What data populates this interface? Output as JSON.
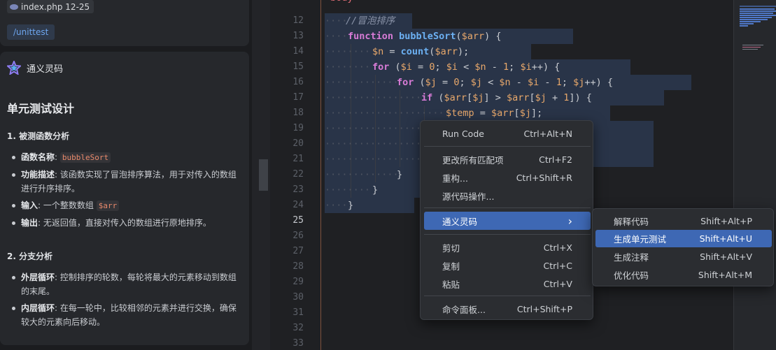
{
  "chat": {
    "file_chip": "index.php 12-25",
    "command": "/unittest",
    "assistant_name": "通义灵码",
    "heading": "单元测试设计",
    "section1": {
      "title": "1. 被测函数分析",
      "items": [
        {
          "label": "函数名称",
          "sep": ": ",
          "code": "bubbleSort",
          "text": ""
        },
        {
          "label": "功能描述",
          "sep": ": ",
          "code": "",
          "text": "该函数实现了冒泡排序算法，用于对传入的数组进行升序排序。"
        },
        {
          "label": "输入",
          "sep": ": 一个整数数组 ",
          "code": "$arr",
          "text": ""
        },
        {
          "label": "输出",
          "sep": ": ",
          "code": "",
          "text": "无返回值，直接对传入的数组进行原地排序。"
        }
      ]
    },
    "section2": {
      "title": "2. 分支分析",
      "items": [
        {
          "label": "外层循环",
          "sep": ": ",
          "code": "",
          "text": "控制排序的轮数，每轮将最大的元素移动到数组的末尾。"
        },
        {
          "label": "内层循环",
          "sep": ": ",
          "code": "",
          "text": "在每一轮中，比较相邻的元素并进行交换，确保较大的元素向后移动。"
        }
      ]
    }
  },
  "editor": {
    "top_fragment": "<body>",
    "current_line": 25,
    "lines": [
      {
        "n": 12,
        "text": "//冒泡排序"
      },
      {
        "n": 13,
        "text": "function bubbleSort($arr) {"
      },
      {
        "n": 14,
        "text": "$n = count($arr);"
      },
      {
        "n": 15,
        "text": "for ($i = 0; $i < $n - 1; $i++) {"
      },
      {
        "n": 16,
        "text": "for ($j = 0; $j < $n - $i - 1; $j++) {"
      },
      {
        "n": 17,
        "text": "if ($arr[$j] > $arr[$j + 1]) {"
      },
      {
        "n": 18,
        "text": "$temp = $arr[$j];"
      },
      {
        "n": 19,
        "text": ""
      },
      {
        "n": 20,
        "text": ""
      },
      {
        "n": 21,
        "text": ""
      },
      {
        "n": 22,
        "text": "}"
      },
      {
        "n": 23,
        "text": "}"
      },
      {
        "n": 24,
        "text": "}"
      },
      {
        "n": 25,
        "text": ""
      },
      {
        "n": 26,
        "text": ""
      },
      {
        "n": 27,
        "text": ""
      },
      {
        "n": 28,
        "text": ""
      },
      {
        "n": 29,
        "text": ""
      },
      {
        "n": 30,
        "text": ""
      },
      {
        "n": 31,
        "text": ""
      },
      {
        "n": 32,
        "text": ""
      },
      {
        "n": 33,
        "text": ""
      }
    ]
  },
  "context_menu": {
    "run_code": {
      "label": "Run Code",
      "shortcut": "Ctrl+Alt+N"
    },
    "change_all": {
      "label": "更改所有匹配项",
      "shortcut": "Ctrl+F2"
    },
    "refactor": {
      "label": "重构...",
      "shortcut": "Ctrl+Shift+R"
    },
    "source_action": {
      "label": "源代码操作...",
      "shortcut": ""
    },
    "tongyi": {
      "label": "通义灵码",
      "shortcut": "›"
    },
    "cut": {
      "label": "剪切",
      "shortcut": "Ctrl+X"
    },
    "copy": {
      "label": "复制",
      "shortcut": "Ctrl+C"
    },
    "paste": {
      "label": "粘贴",
      "shortcut": "Ctrl+V"
    },
    "palette": {
      "label": "命令面板...",
      "shortcut": "Ctrl+Shift+P"
    }
  },
  "submenu": {
    "explain": {
      "label": "解释代码",
      "shortcut": "Shift+Alt+P"
    },
    "unittest": {
      "label": "生成单元测试",
      "shortcut": "Shift+Alt+U"
    },
    "comment": {
      "label": "生成注释",
      "shortcut": "Shift+Alt+V"
    },
    "optimize": {
      "label": "优化代码",
      "shortcut": "Shift+Alt+M"
    }
  },
  "colors": {
    "accent": "#3e68b4",
    "keyword": "#d77bd6",
    "function": "#6cb0f2",
    "variable": "#e8a86b",
    "comment": "#8a93a8"
  }
}
